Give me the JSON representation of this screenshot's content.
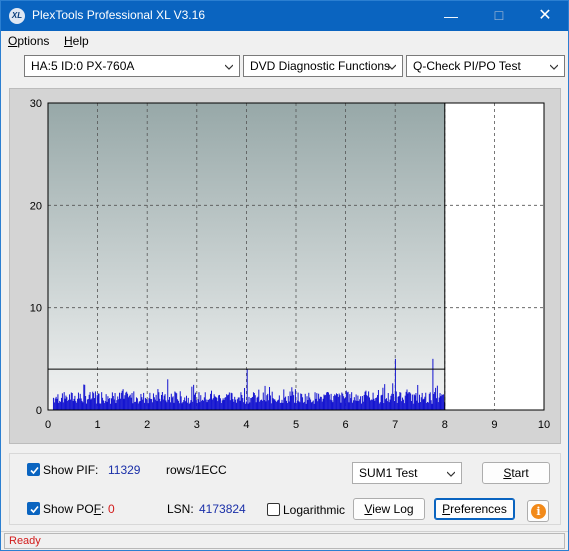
{
  "window": {
    "title": "PlexTools Professional XL V3.16",
    "icon_text": "XL",
    "minimize_glyph": "—",
    "maximize_glyph": "☐",
    "close_glyph": "✕"
  },
  "menu": {
    "items": [
      {
        "label_ul": "O",
        "label_rest": "ptions"
      },
      {
        "label_ul": "H",
        "label_rest": "elp"
      }
    ]
  },
  "toolbar": {
    "drive": "HA:5 ID:0  PX-760A",
    "function": "DVD Diagnostic Functions",
    "test": "Q-Check PI/PO Test"
  },
  "chart_data": {
    "type": "bar",
    "x_ticks": [
      "0",
      "1",
      "2",
      "3",
      "4",
      "5",
      "6",
      "7",
      "8",
      "9",
      "10"
    ],
    "y_ticks": [
      "0",
      "10",
      "20",
      "30"
    ],
    "xlim": [
      0,
      10
    ],
    "ylim": [
      0,
      30
    ],
    "end_marker_x": 8,
    "threshold_y": 4,
    "grid": true,
    "spikes": [
      {
        "x": 2.4,
        "y": 3
      },
      {
        "x": 4.0,
        "y": 4
      },
      {
        "x": 7.0,
        "y": 5
      },
      {
        "x": 7.75,
        "y": 5
      }
    ],
    "colors": {
      "bars": "#1515d0",
      "plot_top": "#97a8a8",
      "plot_bottom": "#f3f4f4",
      "empty": "#ffffff"
    }
  },
  "controls": {
    "show_pif_label": "Show PIF:",
    "pif_value": "11329",
    "pif_units": "rows/1ECC",
    "show_pof_prefix": "Show PO",
    "show_pof_ul": "F",
    "show_pof_suffix": ":",
    "pof_value": "0",
    "lsn_label": "LSN:",
    "lsn_value": "4173824",
    "logarithmic_label": "Logarithmic",
    "sum_select": "SUM1 Test",
    "start_ul": "S",
    "start_rest": "tart",
    "viewlog_ul": "V",
    "viewlog_rest": "iew Log",
    "preferences_ul": "P",
    "preferences_rest": "references",
    "info_glyph": "i"
  },
  "status": {
    "text": "Ready"
  }
}
